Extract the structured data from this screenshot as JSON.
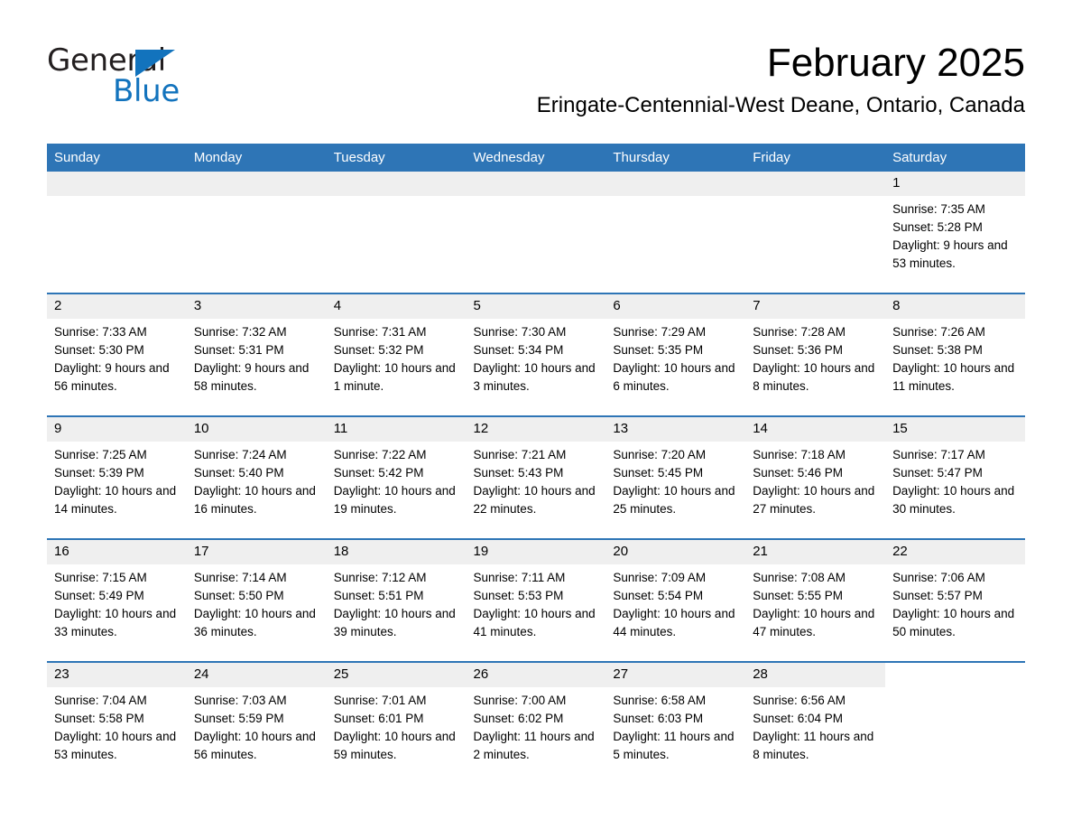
{
  "brand": {
    "line1": "General",
    "line2": "Blue",
    "triangle_color": "#1273bd"
  },
  "header": {
    "title": "February 2025",
    "subtitle": "Eringate-Centennial-West Deane, Ontario, Canada"
  },
  "colors": {
    "header_blue": "#2e75b6",
    "daynum_strip": "#efefef",
    "text": "#000000",
    "brand_blue": "#1273bd"
  },
  "weekdays": [
    {
      "label": "Sunday"
    },
    {
      "label": "Monday"
    },
    {
      "label": "Tuesday"
    },
    {
      "label": "Wednesday"
    },
    {
      "label": "Thursday"
    },
    {
      "label": "Friday"
    },
    {
      "label": "Saturday"
    }
  ],
  "weeks": [
    [
      {
        "day": "",
        "empty": true
      },
      {
        "day": "",
        "empty": true
      },
      {
        "day": "",
        "empty": true
      },
      {
        "day": "",
        "empty": true
      },
      {
        "day": "",
        "empty": true
      },
      {
        "day": "",
        "empty": true
      },
      {
        "day": "1",
        "sunrise": "Sunrise: 7:35 AM",
        "sunset": "Sunset: 5:28 PM",
        "daylight": "Daylight: 9 hours and 53 minutes."
      }
    ],
    [
      {
        "day": "2",
        "sunrise": "Sunrise: 7:33 AM",
        "sunset": "Sunset: 5:30 PM",
        "daylight": "Daylight: 9 hours and 56 minutes."
      },
      {
        "day": "3",
        "sunrise": "Sunrise: 7:32 AM",
        "sunset": "Sunset: 5:31 PM",
        "daylight": "Daylight: 9 hours and 58 minutes."
      },
      {
        "day": "4",
        "sunrise": "Sunrise: 7:31 AM",
        "sunset": "Sunset: 5:32 PM",
        "daylight": "Daylight: 10 hours and 1 minute."
      },
      {
        "day": "5",
        "sunrise": "Sunrise: 7:30 AM",
        "sunset": "Sunset: 5:34 PM",
        "daylight": "Daylight: 10 hours and 3 minutes."
      },
      {
        "day": "6",
        "sunrise": "Sunrise: 7:29 AM",
        "sunset": "Sunset: 5:35 PM",
        "daylight": "Daylight: 10 hours and 6 minutes."
      },
      {
        "day": "7",
        "sunrise": "Sunrise: 7:28 AM",
        "sunset": "Sunset: 5:36 PM",
        "daylight": "Daylight: 10 hours and 8 minutes."
      },
      {
        "day": "8",
        "sunrise": "Sunrise: 7:26 AM",
        "sunset": "Sunset: 5:38 PM",
        "daylight": "Daylight: 10 hours and 11 minutes."
      }
    ],
    [
      {
        "day": "9",
        "sunrise": "Sunrise: 7:25 AM",
        "sunset": "Sunset: 5:39 PM",
        "daylight": "Daylight: 10 hours and 14 minutes."
      },
      {
        "day": "10",
        "sunrise": "Sunrise: 7:24 AM",
        "sunset": "Sunset: 5:40 PM",
        "daylight": "Daylight: 10 hours and 16 minutes."
      },
      {
        "day": "11",
        "sunrise": "Sunrise: 7:22 AM",
        "sunset": "Sunset: 5:42 PM",
        "daylight": "Daylight: 10 hours and 19 minutes."
      },
      {
        "day": "12",
        "sunrise": "Sunrise: 7:21 AM",
        "sunset": "Sunset: 5:43 PM",
        "daylight": "Daylight: 10 hours and 22 minutes."
      },
      {
        "day": "13",
        "sunrise": "Sunrise: 7:20 AM",
        "sunset": "Sunset: 5:45 PM",
        "daylight": "Daylight: 10 hours and 25 minutes."
      },
      {
        "day": "14",
        "sunrise": "Sunrise: 7:18 AM",
        "sunset": "Sunset: 5:46 PM",
        "daylight": "Daylight: 10 hours and 27 minutes."
      },
      {
        "day": "15",
        "sunrise": "Sunrise: 7:17 AM",
        "sunset": "Sunset: 5:47 PM",
        "daylight": "Daylight: 10 hours and 30 minutes."
      }
    ],
    [
      {
        "day": "16",
        "sunrise": "Sunrise: 7:15 AM",
        "sunset": "Sunset: 5:49 PM",
        "daylight": "Daylight: 10 hours and 33 minutes."
      },
      {
        "day": "17",
        "sunrise": "Sunrise: 7:14 AM",
        "sunset": "Sunset: 5:50 PM",
        "daylight": "Daylight: 10 hours and 36 minutes."
      },
      {
        "day": "18",
        "sunrise": "Sunrise: 7:12 AM",
        "sunset": "Sunset: 5:51 PM",
        "daylight": "Daylight: 10 hours and 39 minutes."
      },
      {
        "day": "19",
        "sunrise": "Sunrise: 7:11 AM",
        "sunset": "Sunset: 5:53 PM",
        "daylight": "Daylight: 10 hours and 41 minutes."
      },
      {
        "day": "20",
        "sunrise": "Sunrise: 7:09 AM",
        "sunset": "Sunset: 5:54 PM",
        "daylight": "Daylight: 10 hours and 44 minutes."
      },
      {
        "day": "21",
        "sunrise": "Sunrise: 7:08 AM",
        "sunset": "Sunset: 5:55 PM",
        "daylight": "Daylight: 10 hours and 47 minutes."
      },
      {
        "day": "22",
        "sunrise": "Sunrise: 7:06 AM",
        "sunset": "Sunset: 5:57 PM",
        "daylight": "Daylight: 10 hours and 50 minutes."
      }
    ],
    [
      {
        "day": "23",
        "sunrise": "Sunrise: 7:04 AM",
        "sunset": "Sunset: 5:58 PM",
        "daylight": "Daylight: 10 hours and 53 minutes."
      },
      {
        "day": "24",
        "sunrise": "Sunrise: 7:03 AM",
        "sunset": "Sunset: 5:59 PM",
        "daylight": "Daylight: 10 hours and 56 minutes."
      },
      {
        "day": "25",
        "sunrise": "Sunrise: 7:01 AM",
        "sunset": "Sunset: 6:01 PM",
        "daylight": "Daylight: 10 hours and 59 minutes."
      },
      {
        "day": "26",
        "sunrise": "Sunrise: 7:00 AM",
        "sunset": "Sunset: 6:02 PM",
        "daylight": "Daylight: 11 hours and 2 minutes."
      },
      {
        "day": "27",
        "sunrise": "Sunrise: 6:58 AM",
        "sunset": "Sunset: 6:03 PM",
        "daylight": "Daylight: 11 hours and 5 minutes."
      },
      {
        "day": "28",
        "sunrise": "Sunrise: 6:56 AM",
        "sunset": "Sunset: 6:04 PM",
        "daylight": "Daylight: 11 hours and 8 minutes."
      },
      {
        "day": "",
        "empty": true,
        "no_fill": true
      }
    ]
  ]
}
